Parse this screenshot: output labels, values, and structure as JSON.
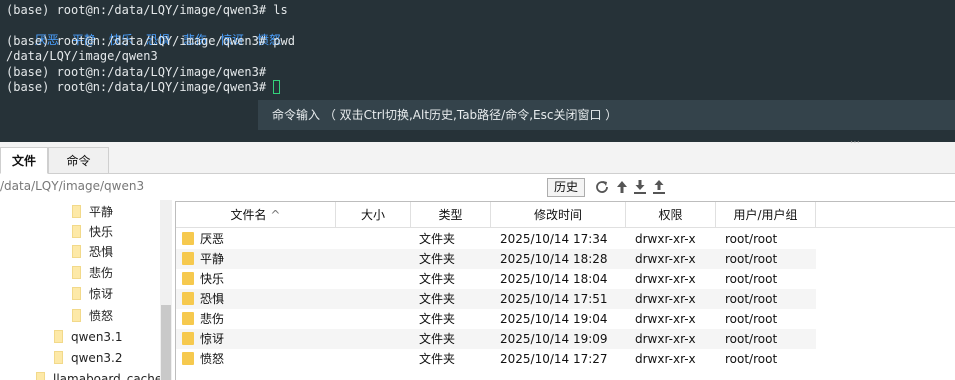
{
  "terminal": {
    "line1": "(base) root@n:/data/LQY/image/qwen3# ls",
    "ls_output": [
      "厌恶",
      "平静",
      "快乐",
      "恐惧",
      "悲伤",
      "惊讶",
      "愤怒"
    ],
    "line3": "(base) root@n:/data/LQY/image/qwen3# pwd",
    "line4": "/data/LQY/image/qwen3",
    "line5": "(base) root@n:/data/LQY/image/qwen3#",
    "line6": "(base) root@n:/data/LQY/image/qwen3#",
    "command_bar_hint": "命令输入 （ 双击Ctrl切换,Alt历史,Tab路径/命令,Esc关闭窗口 ）"
  },
  "tabs": [
    {
      "label": "文件",
      "active": true
    },
    {
      "label": "命令",
      "active": false
    }
  ],
  "pathbar": {
    "path": "/data/LQY/image/qwen3",
    "history_label": "历史",
    "icons": [
      "refresh-icon",
      "up-arrow-icon",
      "download-icon",
      "upload-icon"
    ]
  },
  "tree": {
    "items": [
      {
        "label": "平静"
      },
      {
        "label": "快乐"
      },
      {
        "label": "恐惧"
      },
      {
        "label": "悲伤"
      },
      {
        "label": "惊讶"
      },
      {
        "label": "愤怒"
      },
      {
        "label": "qwen3.1"
      },
      {
        "label": "qwen3.2"
      },
      {
        "label": "llamaboard_cache"
      }
    ]
  },
  "filelist": {
    "columns": [
      "文件名",
      "大小",
      "类型",
      "修改时间",
      "权限",
      "用户/用户组"
    ],
    "sort_indicator": "^",
    "rows": [
      {
        "name": "厌恶",
        "size": "",
        "type": "文件夹",
        "mtime": "2025/10/14 17:34",
        "perm": "drwxr-xr-x",
        "owner": "root/root"
      },
      {
        "name": "平静",
        "size": "",
        "type": "文件夹",
        "mtime": "2025/10/14 18:28",
        "perm": "drwxr-xr-x",
        "owner": "root/root"
      },
      {
        "name": "快乐",
        "size": "",
        "type": "文件夹",
        "mtime": "2025/10/14 18:04",
        "perm": "drwxr-xr-x",
        "owner": "root/root"
      },
      {
        "name": "恐惧",
        "size": "",
        "type": "文件夹",
        "mtime": "2025/10/14 17:51",
        "perm": "drwxr-xr-x",
        "owner": "root/root"
      },
      {
        "name": "悲伤",
        "size": "",
        "type": "文件夹",
        "mtime": "2025/10/14 19:04",
        "perm": "drwxr-xr-x",
        "owner": "root/root"
      },
      {
        "name": "惊讶",
        "size": "",
        "type": "文件夹",
        "mtime": "2025/10/14 19:09",
        "perm": "drwxr-xr-x",
        "owner": "root/root"
      },
      {
        "name": "愤怒",
        "size": "",
        "type": "文件夹",
        "mtime": "2025/10/14 17:27",
        "perm": "drwxr-xr-x",
        "owner": "root/root"
      }
    ]
  }
}
